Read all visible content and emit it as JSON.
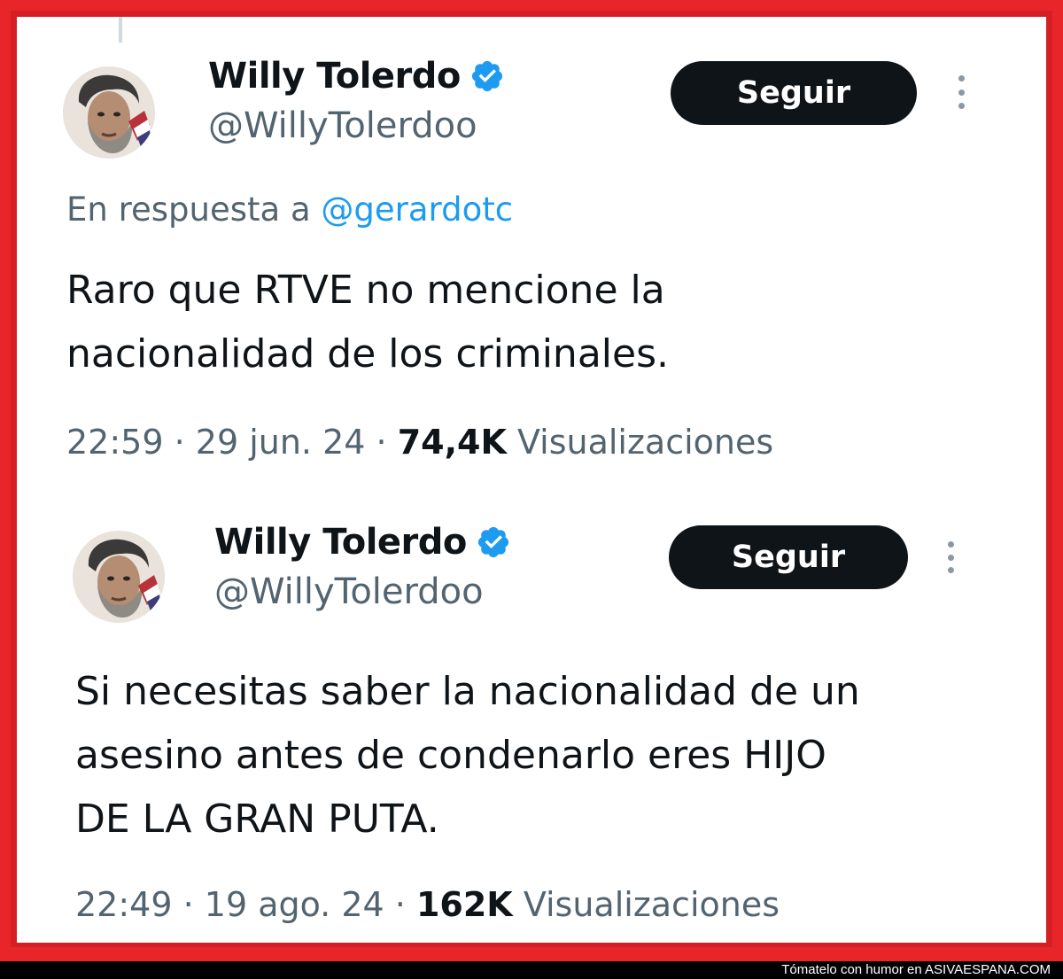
{
  "tweets": [
    {
      "author_name": "Willy Tolerdo",
      "author_handle": "@WillyTolerdoo",
      "follow_label": "Seguir",
      "reply_prefix": "En respuesta a ",
      "reply_mention": "@gerardotc",
      "text_lines": [
        "Raro que RTVE no mencione la",
        "nacionalidad de los criminales."
      ],
      "time": "22:59",
      "date": "29 jun. 24",
      "views_count": "74,4K",
      "views_label": "Visualizaciones"
    },
    {
      "author_name": "Willy Tolerdo",
      "author_handle": "@WillyTolerdoo",
      "follow_label": "Seguir",
      "text_lines": [
        "Si necesitas saber la nacionalidad de un",
        "asesino antes de condenarlo eres HIJO",
        "DE LA GRAN PUTA."
      ],
      "time": "22:49",
      "date": "19 ago. 24",
      "views_count": "162K",
      "views_label": "Visualizaciones"
    }
  ],
  "separator": " · ",
  "footer": {
    "text": "Tómatelo con humor en",
    "site": "ASIVAESPANA.COM"
  },
  "colors": {
    "frame": "#e8262a",
    "verified": "#1d9bf0",
    "mention": "#1d9bf0",
    "button": "#0f1419",
    "secondary_text": "#536471"
  },
  "icons": [
    "verified-badge-icon",
    "more-options-icon"
  ]
}
